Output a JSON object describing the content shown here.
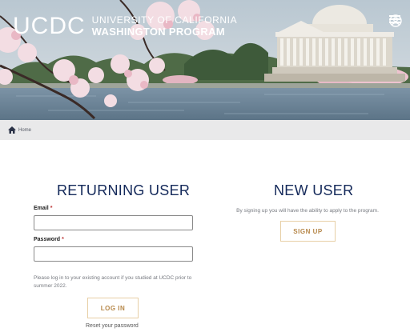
{
  "header": {
    "logo_mark": "UCDC",
    "logo_line1": "UNIVERSITY OF CALIFORNIA",
    "logo_line2": "WASHINGTON PROGRAM",
    "account_icon": "user-circle-icon",
    "menu_icon": "hamburger-menu-icon"
  },
  "breadcrumb": {
    "home_icon": "home-icon",
    "home_label": "Home"
  },
  "returning_user": {
    "title": "RETURNING USER",
    "email_label": "Email",
    "email_value": "",
    "password_label": "Password",
    "password_value": "",
    "required_mark": "*",
    "note": "Please log in to your existing account if you studied at UCDC prior to summer 2022.",
    "login_button": "LOG IN",
    "reset_link": "Reset your password"
  },
  "new_user": {
    "title": "NEW USER",
    "description": "By signing up you will have the ability to apply to the program.",
    "signup_button": "SIGN UP"
  },
  "colors": {
    "title_navy": "#14295a",
    "button_gold_text": "#b7884a",
    "button_gold_border": "#e7cfa6",
    "breadcrumb_bg": "#e9e9ea"
  }
}
